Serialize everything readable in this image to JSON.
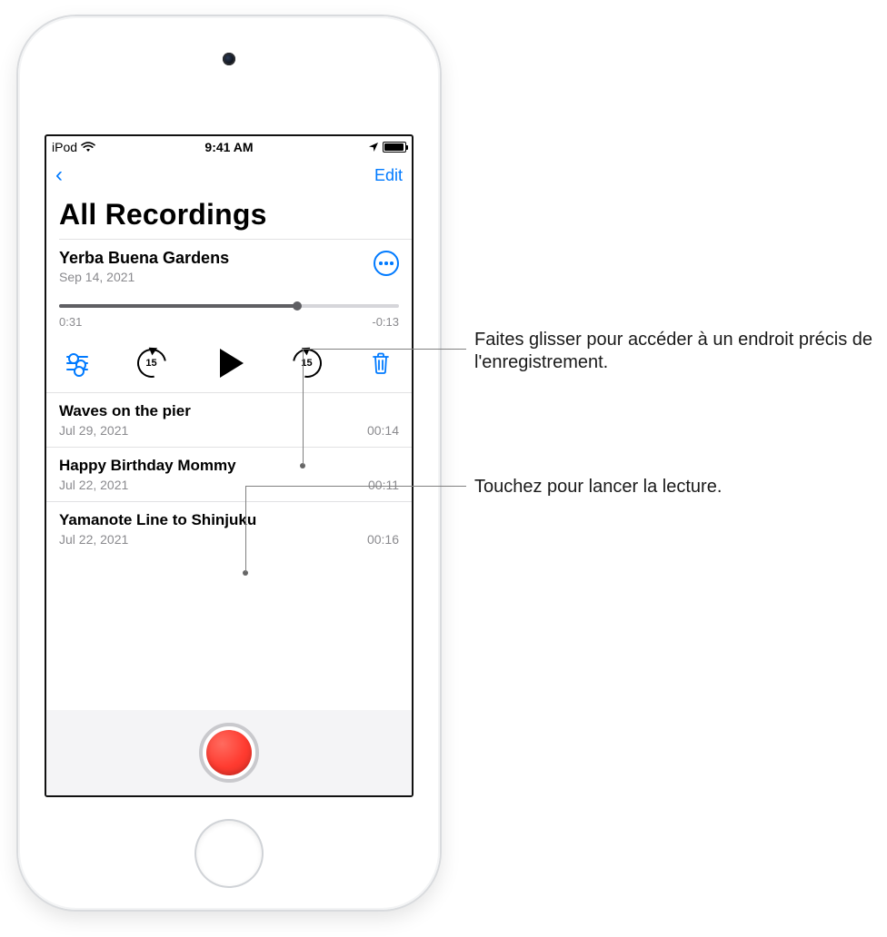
{
  "status": {
    "carrier": "iPod",
    "time": "9:41 AM"
  },
  "nav": {
    "edit": "Edit"
  },
  "page_title": "All Recordings",
  "expanded": {
    "title": "Yerba Buena Gardens",
    "date": "Sep 14, 2021",
    "elapsed": "0:31",
    "remaining": "-0:13",
    "skip_back_label": "15",
    "skip_fwd_label": "15",
    "progress_pct": 70
  },
  "items": [
    {
      "title": "Waves on the pier",
      "date": "Jul 29, 2021",
      "duration": "00:14"
    },
    {
      "title": "Happy Birthday Mommy",
      "date": "Jul 22, 2021",
      "duration": "00:11"
    },
    {
      "title": "Yamanote Line to Shinjuku",
      "date": "Jul 22, 2021",
      "duration": "00:16"
    }
  ],
  "callouts": {
    "slider": "Faites glisser pour accéder à un endroit précis de l'enregistrement.",
    "play": "Touchez pour lancer la lecture."
  }
}
